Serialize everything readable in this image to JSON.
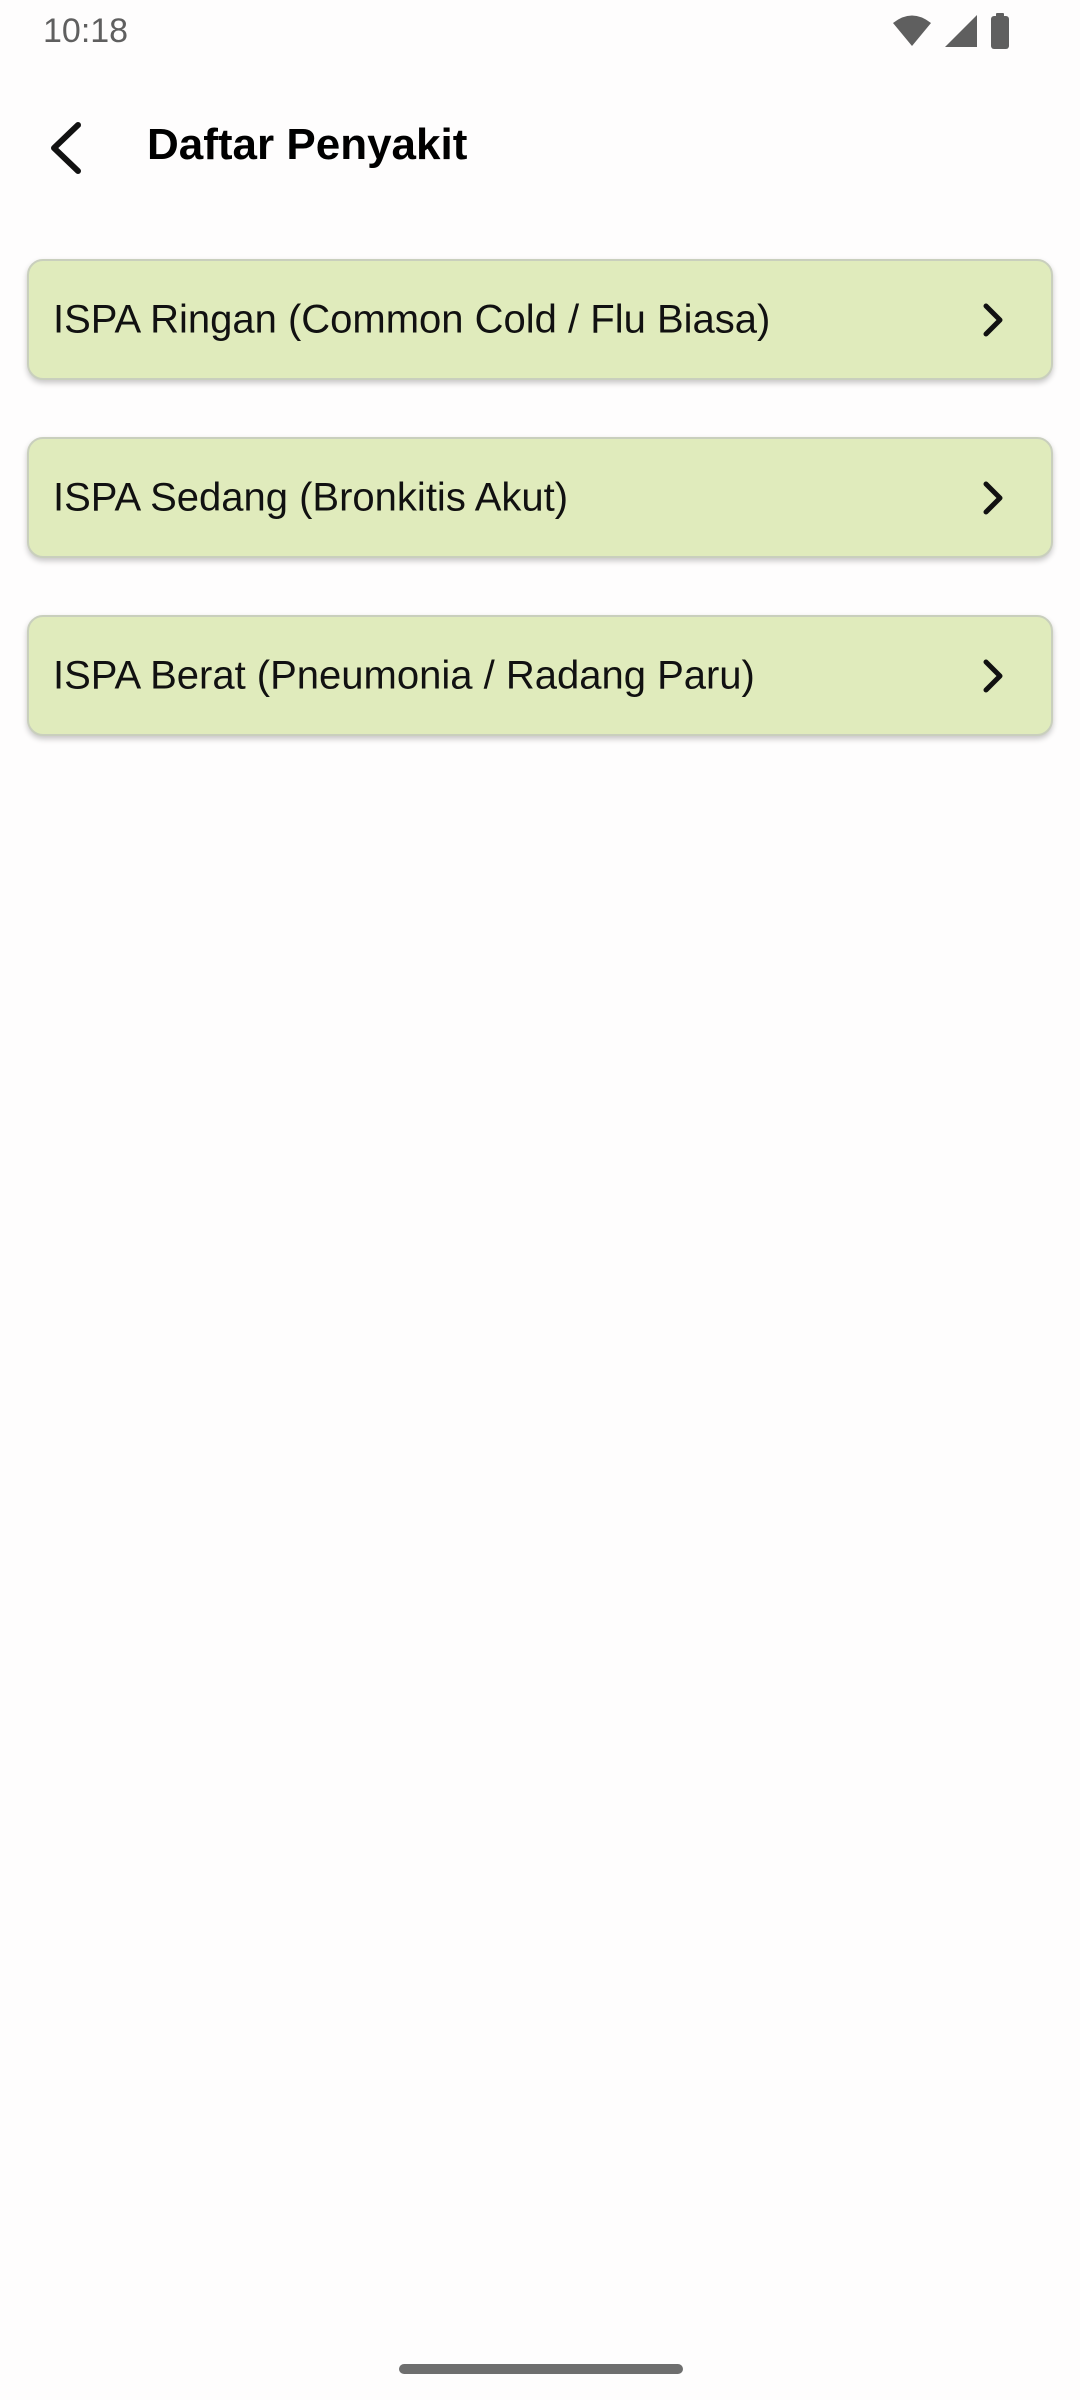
{
  "status_bar": {
    "time": "10:18",
    "icons": [
      "wifi-icon",
      "cellular-signal-icon",
      "battery-icon"
    ]
  },
  "app_bar": {
    "back_icon": "arrow-back-icon",
    "title": "Daftar Penyakit"
  },
  "diseases": [
    {
      "label": "ISPA Ringan (Common Cold / Flu Biasa)",
      "icon": "chevron-right-icon"
    },
    {
      "label": "ISPA Sedang (Bronkitis Akut)",
      "icon": "chevron-right-icon"
    },
    {
      "label": "ISPA Berat (Pneumonia / Radang Paru)",
      "icon": "chevron-right-icon"
    }
  ],
  "colors": {
    "card_background": "#e0ebbc",
    "background": "#fefdfd"
  }
}
